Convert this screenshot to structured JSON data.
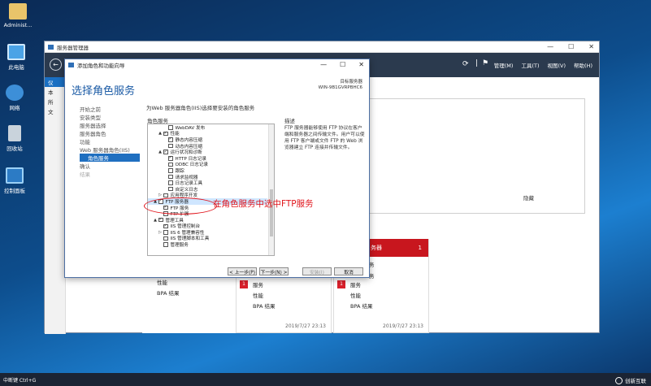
{
  "desktop": {
    "icons": [
      {
        "label": "Administ..."
      },
      {
        "label": "此电脑"
      },
      {
        "label": "网络"
      },
      {
        "label": "回收站"
      },
      {
        "label": "控制面板"
      }
    ]
  },
  "server_manager": {
    "title": "服务器管理器",
    "menu": [
      "管理(M)",
      "工具(T)",
      "视图(V)",
      "帮助(H)"
    ],
    "sidebar_items": [
      "仪",
      "本",
      "所",
      "文"
    ],
    "hide_label": "隐藏",
    "tiles": [
      {
        "rows": [
          "性能",
          "BPA 结果"
        ],
        "date": ""
      },
      {
        "rows": [
          "服务",
          "性能",
          "BPA 结果"
        ],
        "badge": "1",
        "date": "2019/7/27 23:13"
      },
      {
        "rows": [
          "服务",
          "性能",
          "BPA 结果"
        ],
        "badge": "1",
        "date": "2019/7/27 23:13"
      }
    ],
    "red_tile": {
      "title": "务器",
      "count": "1"
    },
    "side_labels": [
      "务",
      "务"
    ]
  },
  "wizard": {
    "title": "添加角色和功能向导",
    "heading": "选择角色服务",
    "dest_label": "目标服务器",
    "dest_server": "WIN-9B1GVRPBHC6",
    "steps": [
      {
        "label": "开始之前",
        "sub": false,
        "state": ""
      },
      {
        "label": "安装类型",
        "sub": false,
        "state": ""
      },
      {
        "label": "服务器选择",
        "sub": false,
        "state": ""
      },
      {
        "label": "服务器角色",
        "sub": false,
        "state": ""
      },
      {
        "label": "功能",
        "sub": false,
        "state": ""
      },
      {
        "label": "Web 服务器角色(IIS)",
        "sub": false,
        "state": ""
      },
      {
        "label": "角色服务",
        "sub": true,
        "state": "sel"
      },
      {
        "label": "确认",
        "sub": false,
        "state": ""
      },
      {
        "label": "结果",
        "sub": false,
        "state": "dim"
      }
    ],
    "instruction": "为Web 服务器角色(IIS)选择要安装的角色服务",
    "role_services_header": "角色服务",
    "description_header": "描述",
    "description_text": "FTP 服务器能够使用 FTP 协议在客户端和服务器之间传输文件。用户可以使用 FTP 客户端或文件 FTP 的 Web 浏览器建立 FTP 连接并传输文件。",
    "tree": [
      {
        "indent": 3,
        "exp": "",
        "cb": "",
        "label": "WebDAV 发布"
      },
      {
        "indent": 2,
        "exp": "▲",
        "cb": "✓",
        "label": "性能"
      },
      {
        "indent": 3,
        "exp": "",
        "cb": "✓",
        "label": "静态内容压缩"
      },
      {
        "indent": 3,
        "exp": "",
        "cb": "",
        "label": "动态内容压缩"
      },
      {
        "indent": 2,
        "exp": "▲",
        "cb": "✓",
        "label": "运行状况和诊断"
      },
      {
        "indent": 3,
        "exp": "",
        "cb": "✓",
        "label": "HTTP 日志记录"
      },
      {
        "indent": 3,
        "exp": "",
        "cb": "",
        "label": "ODBC 日志记录"
      },
      {
        "indent": 3,
        "exp": "",
        "cb": "",
        "label": "跟踪"
      },
      {
        "indent": 3,
        "exp": "",
        "cb": "",
        "label": "请求监视器"
      },
      {
        "indent": 3,
        "exp": "",
        "cb": "",
        "label": "日志记录工具"
      },
      {
        "indent": 3,
        "exp": "",
        "cb": "",
        "label": "自定义日志"
      },
      {
        "indent": 2,
        "exp": "▷",
        "cb": "",
        "label": "应用程序开发"
      },
      {
        "indent": 1,
        "exp": "▲",
        "cb": "✓",
        "label": "FTP 服务器",
        "hl": true
      },
      {
        "indent": 2,
        "exp": "",
        "cb": "✓",
        "label": "FTP 服务"
      },
      {
        "indent": 2,
        "exp": "",
        "cb": "",
        "label": "FTP 扩展"
      },
      {
        "indent": 1,
        "exp": "▲",
        "cb": "✓",
        "label": "管理工具"
      },
      {
        "indent": 2,
        "exp": "",
        "cb": "✓",
        "label": "IIS 管理控制台"
      },
      {
        "indent": 2,
        "exp": "▷",
        "cb": "",
        "label": "IIS 6 管理兼容性"
      },
      {
        "indent": 2,
        "exp": "",
        "cb": "",
        "label": "IIS 管理脚本和工具"
      },
      {
        "indent": 2,
        "exp": "",
        "cb": "",
        "label": "管理服务"
      }
    ],
    "buttons": {
      "prev": "< 上一步(P)",
      "next": "下一步(N) >",
      "install": "安装(I)",
      "cancel": "取消"
    }
  },
  "annotation": {
    "text": "在角色服务中选中FTP服务",
    "color": "#e0131a"
  },
  "taskbar": {
    "hint": "中断键 Ctrl+G"
  },
  "watermark": {
    "text": "创新互联"
  }
}
